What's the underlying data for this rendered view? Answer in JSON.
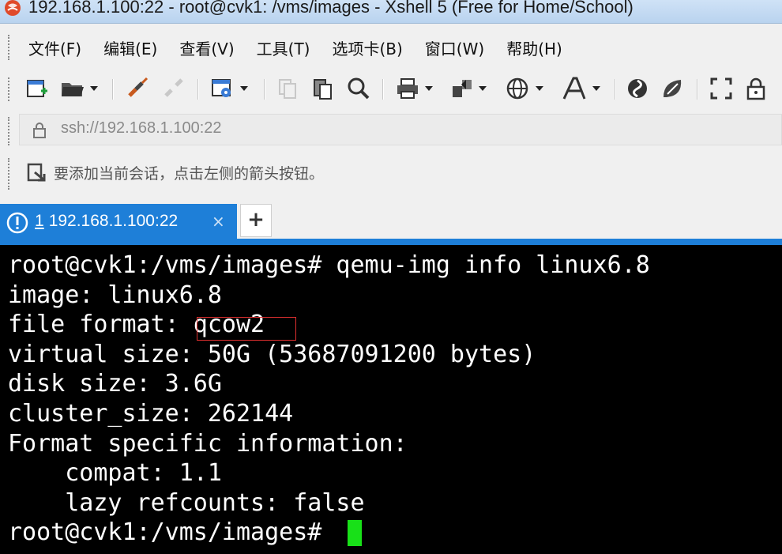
{
  "window": {
    "title": "192.168.1.100:22 - root@cvk1: /vms/images - Xshell 5 (Free for Home/School)"
  },
  "menu": {
    "items": [
      "文件(F)",
      "编辑(E)",
      "查看(V)",
      "工具(T)",
      "选项卡(B)",
      "窗口(W)",
      "帮助(H)"
    ]
  },
  "toolbar": {
    "icons": [
      "new-session-icon",
      "open-folder-icon",
      "connect-icon",
      "disconnect-icon",
      "properties-icon",
      "copy-icon",
      "paste-icon",
      "find-icon",
      "print-icon",
      "transfer-icon",
      "globe-icon",
      "font-icon",
      "xftp-icon",
      "xmanager-icon",
      "fullscreen-icon",
      "lock-icon"
    ]
  },
  "address": {
    "value": "ssh://192.168.1.100:22"
  },
  "hint": {
    "text": "要添加当前会话，点击左侧的箭头按钮。"
  },
  "tabs": [
    {
      "number": "1",
      "label": "192.168.1.100:22",
      "close": "×",
      "active": true
    }
  ],
  "new_tab": {
    "label": "+"
  },
  "terminal": {
    "lines": [
      "root@cvk1:/vms/images# qemu-img info linux6.8",
      "image: linux6.8",
      "file format: qcow2",
      "virtual size: 50G (53687091200 bytes)",
      "disk size: 3.6G",
      "cluster_size: 262144",
      "Format specific information:",
      "    compat: 1.1",
      "    lazy refcounts: false",
      "root@cvk1:/vms/images# "
    ],
    "highlight_color": "#e03030",
    "cursor_color": "#18e018"
  },
  "colors": {
    "accent": "#1e7fd8",
    "terminal_bg": "#000000",
    "terminal_fg": "#ffffff"
  }
}
